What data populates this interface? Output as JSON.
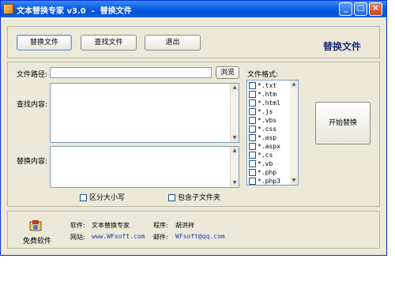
{
  "window": {
    "title": "文本替换专家 v3.0  -  替换文件"
  },
  "toolbar": {
    "replace_files": "替换文件",
    "find_files": "查找文件",
    "exit": "退出",
    "heading": "替换文件"
  },
  "form": {
    "path_label": "文件路径:",
    "browse": "浏览",
    "find_label": "查找内容:",
    "replace_label": "替换内容:",
    "format_label": "文件格式:",
    "start": "开始替换",
    "case_sensitive": "区分大小写",
    "include_subfolders": "包含子文件夹"
  },
  "formats": [
    "*.txt",
    "*.htm",
    "*.html",
    "*.js",
    "*.vbs",
    "*.css",
    "*.asp",
    "*.aspx",
    "*.cs",
    "*.vb",
    "*.php",
    "*.php3"
  ],
  "footer": {
    "free_label": "免费软件",
    "software_label": "软件:",
    "software_value": "文本替换专家",
    "author_label": "程序:",
    "author_value": "胡洪祥",
    "site_label": "网站:",
    "site_value": "www.WFsoft.com",
    "email_label": "邮件:",
    "email_value": "WFsoft@qq.com"
  }
}
